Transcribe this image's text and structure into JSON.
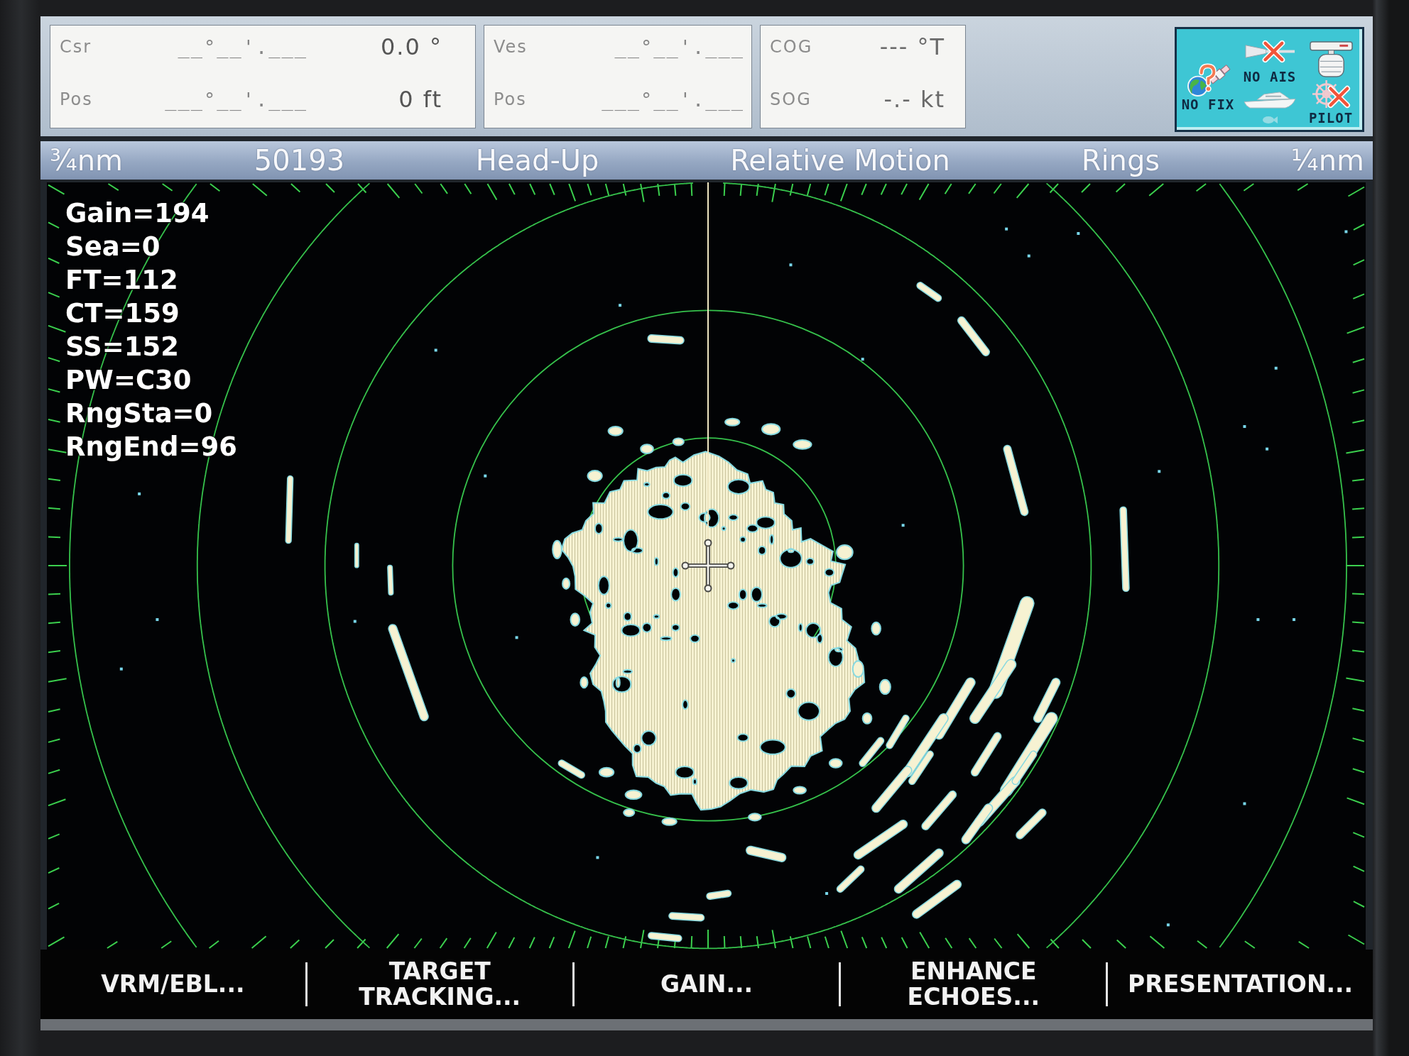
{
  "data_header": {
    "panels": [
      {
        "rows": [
          {
            "label": "Csr",
            "fields": [
              {
                "kind": "coord",
                "text": "__°__'.___"
              },
              {
                "kind": "value",
                "text": "0.0 °"
              }
            ]
          },
          {
            "label": "Pos",
            "fields": [
              {
                "kind": "coord",
                "text": "___°__'.___"
              },
              {
                "kind": "value",
                "text": "0 ft"
              }
            ]
          }
        ]
      },
      {
        "rows": [
          {
            "label": "Ves",
            "fields": [
              {
                "kind": "coord",
                "text": "__°__'.___"
              }
            ]
          },
          {
            "label": "Pos",
            "fields": [
              {
                "kind": "coord",
                "text": "___°__'.___"
              }
            ]
          }
        ]
      },
      {
        "rows": [
          {
            "label": "COG",
            "fields": [
              {
                "kind": "value",
                "text": "--- °T"
              }
            ]
          },
          {
            "label": "SOG",
            "fields": [
              {
                "kind": "value",
                "text": "-.- kt"
              }
            ]
          }
        ]
      }
    ]
  },
  "status_indicators": [
    {
      "kind": "gps",
      "label": "NO FIX",
      "fault": true,
      "dimmed": false
    },
    {
      "kind": "ais",
      "label": "NO AIS",
      "fault": true,
      "dimmed": false
    },
    {
      "kind": "radar",
      "fault": false,
      "dimmed": false
    },
    {
      "kind": "vessel",
      "fault": false,
      "dimmed": false
    },
    {
      "kind": "sonar",
      "fault": false,
      "dimmed": true
    },
    {
      "kind": "autopilot",
      "label": "PILOT",
      "fault": true,
      "dimmed": false
    }
  ],
  "status_bar": [
    "¾nm",
    "50193",
    "Head-Up",
    "Relative Motion",
    "Rings",
    "¼nm"
  ],
  "radar": {
    "settings": [
      "Gain=194",
      "Sea=0",
      "FT=112",
      "CT=159",
      "SS=152",
      "PW=C30",
      "RngSta=0",
      "RngEnd=96"
    ]
  },
  "softkeys": [
    "VRM/EBL...",
    "TARGET TRACKING...",
    "GAIN...",
    "ENHANCE ECHOES...",
    "PRESENTATION..."
  ]
}
